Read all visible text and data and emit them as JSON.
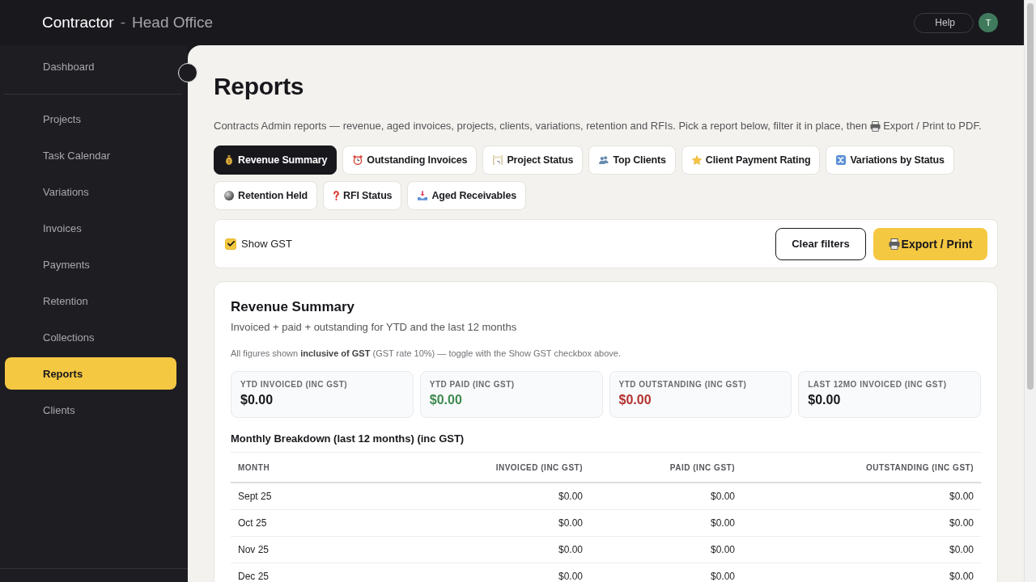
{
  "header": {
    "brand": "Contractor",
    "separator": "-",
    "location": "Head Office",
    "help": "Help",
    "avatar": "T"
  },
  "sidebar": {
    "groups": [
      {
        "items": [
          {
            "label": "Dashboard",
            "selected": false
          }
        ]
      },
      {
        "items": [
          {
            "label": "Projects",
            "selected": false
          },
          {
            "label": "Task Calendar",
            "selected": false
          },
          {
            "label": "Variations",
            "selected": false
          },
          {
            "label": "Invoices",
            "selected": false
          },
          {
            "label": "Payments",
            "selected": false
          },
          {
            "label": "Retention",
            "selected": false
          },
          {
            "label": "Collections",
            "selected": false
          },
          {
            "label": "Reports",
            "selected": true
          },
          {
            "label": "Clients",
            "selected": false
          }
        ]
      }
    ]
  },
  "page": {
    "title": "Reports",
    "description_before": "Contracts Admin reports — revenue, aged invoices, projects, clients, variations, retention and RFIs. Pick a report below, filter it in place, then",
    "description_after": "Export / Print to PDF."
  },
  "report_tabs": [
    {
      "label": "Revenue Summary",
      "selected": true
    },
    {
      "label": "Outstanding Invoices",
      "selected": false
    },
    {
      "label": "Project Status",
      "selected": false
    },
    {
      "label": "Top Clients",
      "selected": false
    },
    {
      "label": "Client Payment Rating",
      "selected": false
    },
    {
      "label": "Variations by Status",
      "selected": false
    },
    {
      "label": "Retention Held",
      "selected": false
    },
    {
      "label": "RFI Status",
      "selected": false
    },
    {
      "label": "Aged Receivables",
      "selected": false
    }
  ],
  "filters": {
    "show_gst": {
      "label": "Show GST",
      "checked": true
    },
    "clear_button": "Clear filters",
    "export_button": "Export / Print"
  },
  "report": {
    "title": "Revenue Summary",
    "subtitle": "Invoiced + paid + outstanding for YTD and the last 12 months",
    "note": "All figures shown **inclusive of GST** (GST rate 10%) — toggle with the Show GST checkbox above.",
    "stats": [
      {
        "label": "YTD INVOICED (INC GST)",
        "value": "$0.00",
        "color": "#18181b"
      },
      {
        "label": "YTD PAID (INC GST)",
        "value": "$0.00",
        "color": "#3f8a4f"
      },
      {
        "label": "YTD OUTSTANDING (INC GST)",
        "value": "$0.00",
        "color": "#b3312f"
      },
      {
        "label": "LAST 12MO INVOICED (INC GST)",
        "value": "$0.00",
        "color": "#18181b"
      }
    ],
    "breakdown_title": "Monthly Breakdown (last 12 months) (inc GST)",
    "table": {
      "columns": [
        "MONTH",
        "INVOICED (INC GST)",
        "PAID (INC GST)",
        "OUTSTANDING (INC GST)"
      ],
      "rows": [
        [
          "Sept 25",
          "$0.00",
          "$0.00",
          "$0.00"
        ],
        [
          "Oct 25",
          "$0.00",
          "$0.00",
          "$0.00"
        ],
        [
          "Nov 25",
          "$0.00",
          "$0.00",
          "$0.00"
        ],
        [
          "Dec 25",
          "$0.00",
          "$0.00",
          "$0.00"
        ]
      ]
    }
  }
}
